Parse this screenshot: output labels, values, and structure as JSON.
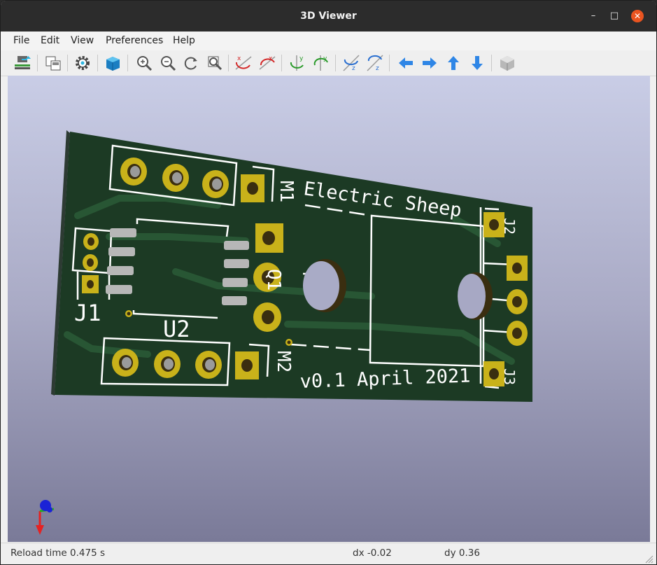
{
  "window": {
    "title": "3D Viewer",
    "minimize": "–",
    "maximize": "□",
    "close": "✕"
  },
  "menu": {
    "file": "File",
    "edit": "Edit",
    "view": "View",
    "preferences": "Preferences",
    "help": "Help"
  },
  "toolbar": {
    "groups": [
      [
        "reload-board-icon"
      ],
      [
        "copy-image-icon"
      ],
      [
        "settings-gear-icon"
      ],
      [
        "raytrace-cube-icon"
      ],
      [
        "zoom-in-icon",
        "zoom-out-icon",
        "refresh-view-icon",
        "zoom-fit-icon"
      ],
      [
        "rotate-x-cw-icon",
        "rotate-x-ccw-icon"
      ],
      [
        "rotate-y-cw-icon",
        "rotate-y-ccw-icon"
      ],
      [
        "rotate-z-cw-icon",
        "rotate-z-ccw-icon"
      ],
      [
        "move-left-icon",
        "move-right-icon",
        "move-up-icon",
        "move-down-icon"
      ],
      [
        "orthographic-cube-icon"
      ]
    ]
  },
  "board": {
    "silkscreen": {
      "title": "Electric Sheep",
      "version": "v0.1 April 2021",
      "j1": "J1",
      "u2": "U2",
      "q1": "Q1",
      "m1": "M1",
      "m2": "M2",
      "j2": "J2",
      "j3": "J3"
    },
    "colors": {
      "soldermask": "#1c3a24",
      "pad": "#c9b21a",
      "silk": "#ffffff",
      "edge": "#2d3b33"
    }
  },
  "status": {
    "reload_time": "Reload time 0.475 s",
    "dx": "dx -0.02",
    "dy": "dy 0.36"
  }
}
